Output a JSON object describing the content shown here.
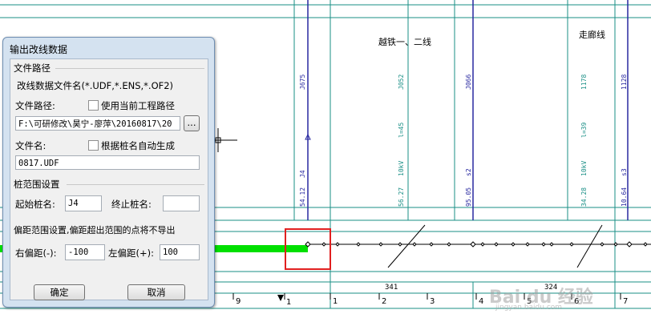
{
  "dialog": {
    "title": "输出改线数据",
    "file_group": {
      "title": "文件路径",
      "name_hint": "改线数据文件名(*.UDF,*.ENS,*.OF2)",
      "path_label": "文件路径:",
      "use_project_path_label": "使用当前工程路径",
      "use_project_path_checked": false,
      "path_value": "F:\\可研修改\\昊宁-廖萍\\20160817\\20",
      "browse_label": "...",
      "filename_label": "文件名:",
      "auto_name_label": "根据桩名自动生成",
      "auto_name_checked": false,
      "filename_value": "0817.UDF"
    },
    "range_group": {
      "title": "桩范围设置",
      "start_label": "起始桩名:",
      "start_value": "J4",
      "end_label": "终止桩名:",
      "end_value": ""
    },
    "offset_group": {
      "title": "偏距范围设置,偏距超出范围的点将不导出",
      "right_label": "右偏距(-):",
      "right_value": "-100",
      "left_label": "左偏距(+):",
      "left_value": "100"
    },
    "ok_label": "确定",
    "cancel_label": "取消"
  },
  "drawing": {
    "crossing_labels": [
      "越铁一、二线",
      "走廊线"
    ],
    "vertical_texts": [
      {
        "top": "J675",
        "mid": "",
        "low": "J4",
        "bottom": "54.12"
      },
      {
        "top": "J052",
        "mid": "l=45",
        "low": "10kV",
        "bottom": "56.27"
      },
      {
        "top": "J066",
        "mid": "",
        "low": "s2",
        "bottom": "95.05"
      },
      {
        "top": "1178",
        "mid": "l=39",
        "low": "10kV",
        "bottom": "34.28"
      },
      {
        "top": "1128",
        "mid": "",
        "low": "s3",
        "bottom": "10.64"
      }
    ],
    "span_labels": [
      "341",
      "324"
    ],
    "ruler_labels": [
      "9",
      "1",
      "1",
      "2",
      "3",
      "4",
      "5",
      "6",
      "7"
    ]
  },
  "colors": {
    "grid": "#1a8f86",
    "blue_line": "#2828a0",
    "green_band": "#00e000",
    "highlight": "#e02020"
  },
  "watermark": {
    "text": "Bai du 经验",
    "url": "jingyan.baidu.com"
  }
}
